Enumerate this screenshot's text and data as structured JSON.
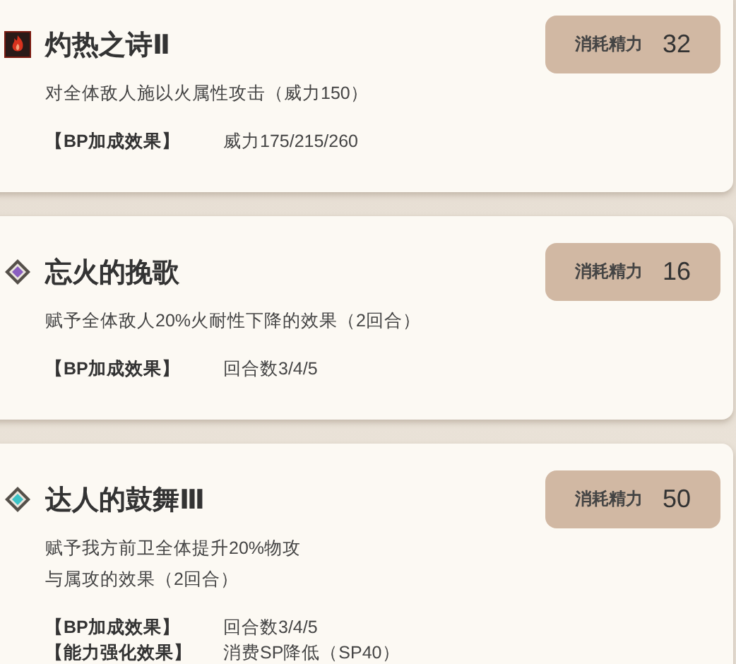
{
  "skills": [
    {
      "kind": "fire",
      "name": "灼热之诗Ⅱ",
      "cost_label": "消耗精力",
      "cost": "32",
      "description": [
        "对全体敌人施以火属性攻击（威力150）"
      ],
      "effects": [
        {
          "label": "【BP加成效果】",
          "value": "威力175/215/260"
        }
      ]
    },
    {
      "kind": "debuff",
      "name": "忘火的挽歌",
      "cost_label": "消耗精力",
      "cost": "16",
      "description": [
        "赋予全体敌人20%火耐性下降的效果（2回合）"
      ],
      "effects": [
        {
          "label": "【BP加成效果】",
          "value": "回合数3/4/5"
        }
      ]
    },
    {
      "kind": "buff",
      "name": "达人的鼓舞Ⅲ",
      "cost_label": "消耗精力",
      "cost": "50",
      "description": [
        "赋予我方前卫全体提升20%物攻",
        "与属攻的效果（2回合）"
      ],
      "effects": [
        {
          "label": "【BP加成效果】",
          "value": "回合数3/4/5"
        },
        {
          "label": "【能力强化效果】",
          "value": "消费SP降低（SP40）"
        }
      ]
    }
  ]
}
